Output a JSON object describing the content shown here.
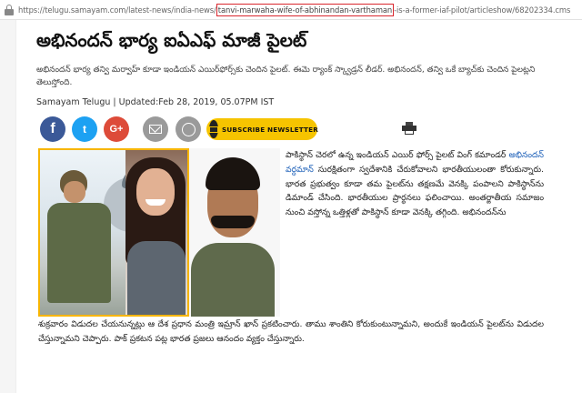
{
  "browser": {
    "url_prefix": "https://telugu.samayam.com/latest-news/india-news/",
    "url_highlight": "tanvi-marwaha-wife-of-abhinandan-varthaman",
    "url_suffix": "-is-a-former-iaf-pilot/articleshow/68202334.cms"
  },
  "article": {
    "headline": "అభినందన్ భార్య ఐఏఎఫ్ మాజీ పైలట్",
    "summary": "అభినందన్ భార్య తన్వి మర్వాహ్ కూడా ఇండియన్ ఎయిర్‌ఫోర్స్‌కు చెందిన పైలట్. ఈమె ర్యాంక్ స్క్వాడ్రన్ లీడర్. అభినందన్, తన్వి ఒకే బ్యాచ్‌కు చెందిన పైలట్లని తెలుస్తోంది.",
    "byline": "Samayam Telugu | Updated:Feb 28, 2019, 05.07PM IST",
    "body_part1": "పాకిస్థాన్ చెరలో ఉన్న ఇండియన్ ఎయిర్ ఫోర్స్ పైలట్ వింగ్ కమాండర్",
    "body_link": "అభినందన్ వర్ధమాన్",
    "body_part2": "సురక్షితంగా స్వదేశానికి చేరుకోవాలని భారతీయులంతా కోరుకున్నారు. భారత ప్రభుత్వం కూడా తమ పైలట్‌ను తక్షణమే వెనక్కి పంపాలని పాకిస్థాన్‌ను డిమాండ్ చేసింది. భారతీయుల ప్రార్థనలు ఫలించాయి. అంతర్జాతీయ సమాజం నుంచి వస్తోన్న ఒత్తిళ్లతో పాకిస్థాన్ కూడా వెనక్కి తగ్గింది. అభినందన్‌ను",
    "body_bottom": "శుక్రవారం విడుదల చేయనున్నట్లు ఆ దేశ ప్రధాన మంత్రి ఇమ్రాన్ ఖాన్ ప్రకటించారు. తాము శాంతిని కోరుకుంటున్నామని, అందుకే ఇండియన్ పైలట్‌ను విడుదల చేస్తున్నామని చెప్పారు. పాక్ ప్రకటన పట్ల భారత ప్రజలు ఆనందం వ్యక్తం చేస్తున్నారు."
  },
  "share": {
    "facebook_glyph": "f",
    "twitter_glyph": "t",
    "googleplus_glyph": "G+",
    "subscribe_label": "SUBSCRIBE NEWSLETTER"
  },
  "colors": {
    "facebook": "#3b5998",
    "twitter": "#1da1f2",
    "googleplus": "#dd4b39",
    "subscribe": "#f6c400",
    "url_highlight_border": "#d9272e",
    "link": "#1c5fb8"
  },
  "icons": [
    "lock-icon",
    "facebook-icon",
    "twitter-icon",
    "google-plus-icon",
    "mail-icon",
    "whatsapp-icon",
    "envelope-icon",
    "print-icon"
  ]
}
